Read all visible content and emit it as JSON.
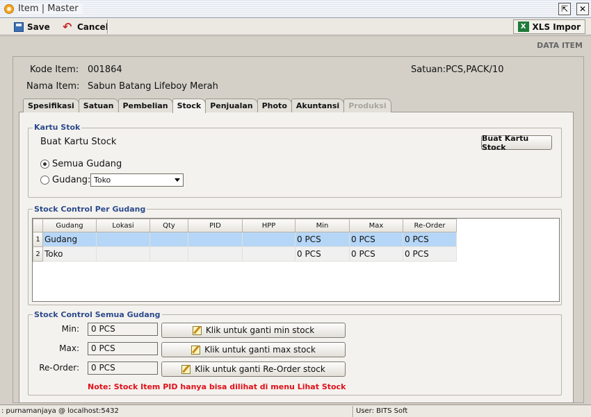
{
  "window": {
    "title": "Item | Master",
    "restore_glyph": "⇱",
    "close_glyph": "✕"
  },
  "toolbar": {
    "save_label": "Save",
    "cancel_label": "Cancel",
    "xls_label": "XLS Impor",
    "xls_icon_text": "X"
  },
  "header_right": "DATA ITEM",
  "item": {
    "kode_label": "Kode Item:",
    "kode_value": "001864",
    "nama_label": "Nama Item:",
    "nama_value": "Sabun Batang Lifeboy Merah",
    "satuan_label": "Satuan:",
    "satuan_value": "PCS,PACK/10"
  },
  "tabs": [
    {
      "label": "Spesifikasi",
      "state": "normal"
    },
    {
      "label": "Satuan",
      "state": "normal"
    },
    {
      "label": "Pembelian",
      "state": "normal"
    },
    {
      "label": "Stock",
      "state": "active"
    },
    {
      "label": "Penjualan",
      "state": "normal"
    },
    {
      "label": "Photo",
      "state": "normal"
    },
    {
      "label": "Akuntansi",
      "state": "normal"
    },
    {
      "label": "Produksi",
      "state": "disabled"
    }
  ],
  "kartu_stok": {
    "group_title": "Kartu Stok",
    "heading": "Buat Kartu Stock",
    "button_label": "Buat Kartu Stock",
    "radio_all_label": "Semua Gudang",
    "radio_gudang_label": "Gudang:",
    "gudang_select_value": "Toko",
    "selected": "all"
  },
  "stock_per_gudang": {
    "group_title": "Stock Control Per Gudang",
    "columns": [
      "Gudang",
      "Lokasi",
      "Qty",
      "PID",
      "HPP",
      "Min",
      "Max",
      "Re-Order"
    ],
    "rows": [
      {
        "no": "1",
        "cells": [
          "Gudang",
          "",
          "",
          "",
          "",
          "0 PCS",
          "0 PCS",
          "0 PCS"
        ]
      },
      {
        "no": "2",
        "cells": [
          "Toko",
          "",
          "",
          "",
          "",
          "0 PCS",
          "0 PCS",
          "0 PCS"
        ]
      }
    ]
  },
  "stock_semua": {
    "group_title": "Stock Control Semua Gudang",
    "min_label": "Min:",
    "min_value": "0 PCS",
    "min_button": "Klik untuk ganti min stock",
    "max_label": "Max:",
    "max_value": "0 PCS",
    "max_button": "Klik untuk ganti max stock",
    "reorder_label": "Re-Order:",
    "reorder_value": "0 PCS",
    "reorder_button": "Klik untuk ganti Re-Order stock",
    "note": "Note: Stock Item PID hanya bisa dilihat di menu Lihat Stock"
  },
  "status": {
    "connection": ": purnamanjaya @ localhost:5432",
    "user": "User: BITS Soft"
  },
  "colors": {
    "accent_title": "#2c4a8c",
    "note": "#e0101a",
    "row_selected": "#b5d6f7"
  }
}
